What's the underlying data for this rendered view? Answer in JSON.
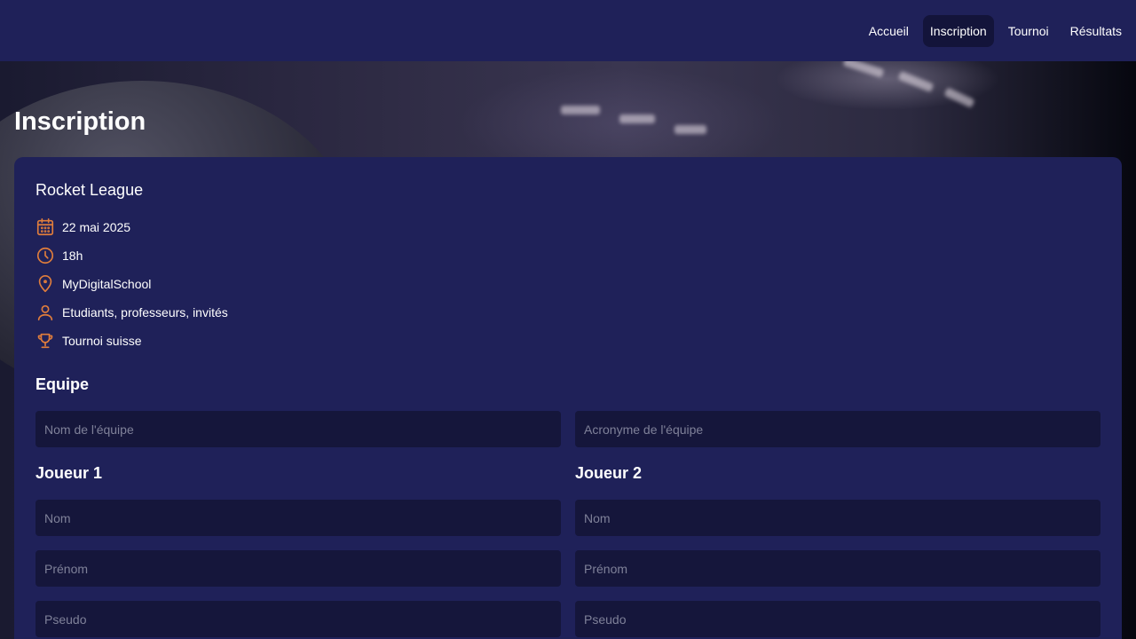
{
  "nav": {
    "items": [
      {
        "label": "Accueil"
      },
      {
        "label": "Inscription",
        "active": true
      },
      {
        "label": "Tournoi"
      },
      {
        "label": "Résultats"
      }
    ]
  },
  "page": {
    "title": "Inscription"
  },
  "event": {
    "name": "Rocket League",
    "date": "22 mai 2025",
    "time": "18h",
    "location": "MyDigitalSchool",
    "audience": "Etudiants, professeurs, invités",
    "format": "Tournoi suisse"
  },
  "team": {
    "title": "Equipe",
    "name_placeholder": "Nom de l'équipe",
    "acronym_placeholder": "Acronyme de l'équipe"
  },
  "player1": {
    "title": "Joueur 1",
    "nom_placeholder": "Nom",
    "prenom_placeholder": "Prénom",
    "pseudo_placeholder": "Pseudo"
  },
  "player2": {
    "title": "Joueur 2",
    "nom_placeholder": "Nom",
    "prenom_placeholder": "Prénom",
    "pseudo_placeholder": "Pseudo"
  },
  "colors": {
    "navbar": "#1f2159",
    "card": "#1f2159",
    "input": "#15163b",
    "accent_icon": "#e07d3c",
    "active_nav": "#13143a"
  },
  "icons": [
    "calendar-icon",
    "clock-icon",
    "location-pin-icon",
    "user-icon",
    "trophy-icon"
  ]
}
